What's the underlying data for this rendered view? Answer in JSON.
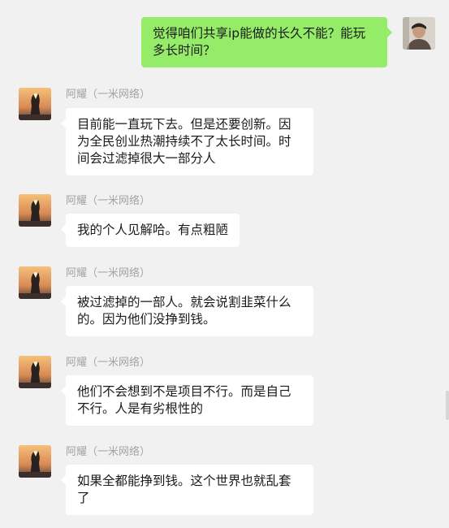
{
  "colors": {
    "background": "#f1f1f1",
    "bubble_incoming": "#ffffff",
    "bubble_outgoing": "#95ec69",
    "sender_name": "#a3a3a3"
  },
  "messages": [
    {
      "direction": "outgoing",
      "text": "觉得咱们共享ip能做的长久不能？能玩多长时间？"
    },
    {
      "direction": "incoming",
      "sender": "阿耀（一米网络）",
      "text": "目前能一直玩下去。但是还要创新。因为全民创业热潮持续不了太长时间。时间会过滤掉很大一部分人"
    },
    {
      "direction": "incoming",
      "sender": "阿耀（一米网络）",
      "text": "我的个人见解哈。有点粗陋"
    },
    {
      "direction": "incoming",
      "sender": "阿耀（一米网络）",
      "text": "被过滤掉的一部人。就会说割韭菜什么的。因为他们没挣到钱。"
    },
    {
      "direction": "incoming",
      "sender": "阿耀（一米网络）",
      "text": "他们不会想到不是项目不行。而是自己不行。人是有劣根性的"
    },
    {
      "direction": "incoming",
      "sender": "阿耀（一米网络）",
      "text": "如果全都能挣到钱。这个世界也就乱套了"
    }
  ]
}
